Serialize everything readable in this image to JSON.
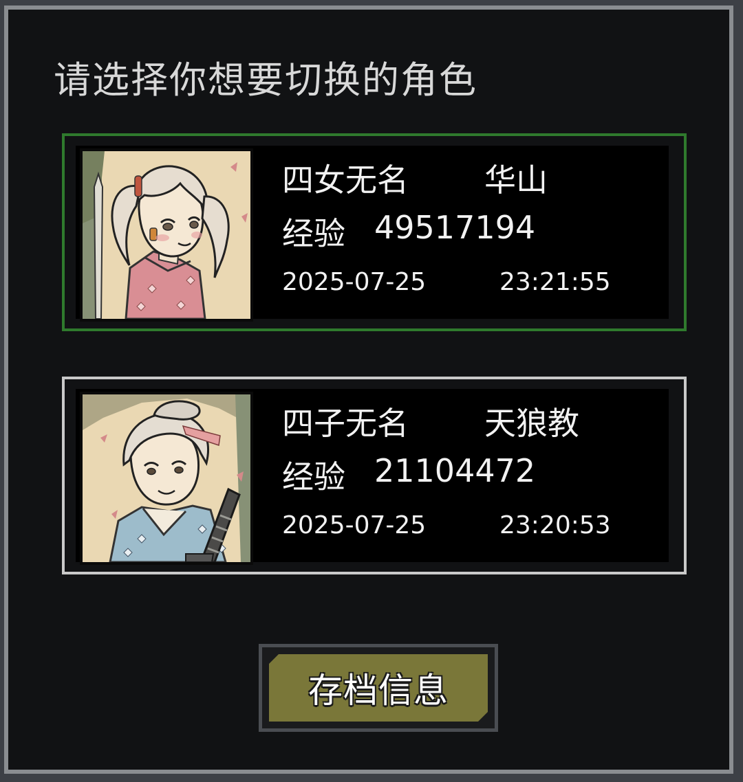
{
  "title": "请选择你想要切换的角色",
  "characters": [
    {
      "name": "四女无名",
      "sect": "华山",
      "exp_label": "经验",
      "exp_value": "49517194",
      "date": "2025-07-25",
      "time": "23:21:55",
      "selected": true,
      "portrait": "female-character-portrait"
    },
    {
      "name": "四子无名",
      "sect": "天狼教",
      "exp_label": "经验",
      "exp_value": "21104472",
      "date": "2025-07-25",
      "time": "23:20:53",
      "selected": false,
      "portrait": "male-character-portrait"
    }
  ],
  "save_button_label": "存档信息",
  "colors": {
    "selected_border": "#2f7a2d",
    "normal_border": "#c9c9c9",
    "button_face": "#7a7739",
    "panel_background": "#111214",
    "panel_border": "#8a8d91"
  }
}
